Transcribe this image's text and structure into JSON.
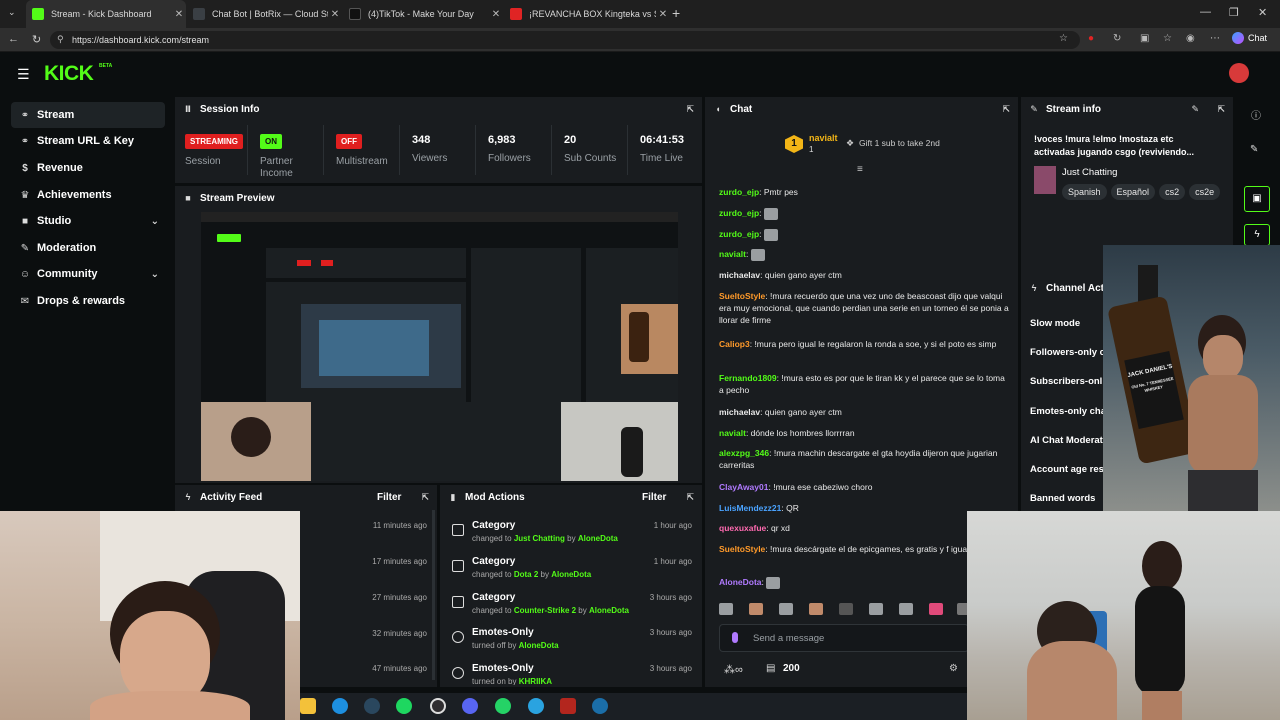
{
  "browser": {
    "tabs": [
      {
        "title": "Stream - Kick Dashboard",
        "active": true,
        "favicon_color": "#53fc18"
      },
      {
        "title": "Chat Bot | BotRix — Cloud Streami",
        "active": false,
        "favicon_color": "#3a3f44"
      },
      {
        "title": "(4)TikTok - Make Your Day",
        "active": false,
        "favicon_color": "#111111"
      },
      {
        "title": "¡REVANCHA BOX Kingteka vs S",
        "active": false,
        "favicon_color": "#e02424"
      }
    ],
    "url": "https://dashboard.kick.com/stream",
    "chat_button": "Chat"
  },
  "app": {
    "logo": "KICK",
    "logo_badge": "BETA",
    "accent": "#53fc18"
  },
  "sidebar": {
    "items": [
      {
        "label": "Stream",
        "icon": "link-icon"
      },
      {
        "label": "Stream URL & Key",
        "icon": "link-icon"
      },
      {
        "label": "Revenue",
        "icon": "dollar-icon"
      },
      {
        "label": "Achievements",
        "icon": "trophy-icon"
      },
      {
        "label": "Studio",
        "icon": "video-icon"
      },
      {
        "label": "Moderation",
        "icon": "wrench-icon"
      },
      {
        "label": "Community",
        "icon": "users-icon"
      },
      {
        "label": "Drops & rewards",
        "icon": "gift-icon"
      }
    ]
  },
  "session": {
    "title": "Session Info",
    "stats": [
      {
        "value": "STREAMING",
        "label": "Session",
        "badge_color": "#e01f1f"
      },
      {
        "value": "ON",
        "label": "Partner Income",
        "badge_color": "#53fc18"
      },
      {
        "value": "OFF",
        "label": "Multistream",
        "badge_color": "#e01f1f"
      },
      {
        "value": "348",
        "label": "Viewers"
      },
      {
        "value": "6,983",
        "label": "Followers"
      },
      {
        "value": "20",
        "label": "Sub Counts"
      },
      {
        "value": "06:41:53",
        "label": "Time Live"
      }
    ]
  },
  "preview": {
    "title": "Stream Preview"
  },
  "activity": {
    "title": "Activity Feed",
    "filter": "Filter",
    "times": [
      "11 minutes ago",
      "17 minutes ago",
      "27 minutes ago",
      "32 minutes ago",
      "47 minutes ago"
    ]
  },
  "mod_actions": {
    "title": "Mod Actions",
    "filter": "Filter",
    "rows": [
      {
        "title": "Category",
        "verb": "changed to",
        "target": "Just Chatting",
        "by": "by",
        "user": "AloneDota",
        "time": "1 hour ago",
        "icon": "category-icon"
      },
      {
        "title": "Category",
        "verb": "changed to",
        "target": "Dota 2",
        "by": "by",
        "user": "AloneDota",
        "time": "1 hour ago",
        "icon": "category-icon"
      },
      {
        "title": "Category",
        "verb": "changed to",
        "target": "Counter-Strike 2",
        "by": "by",
        "user": "AloneDota",
        "time": "3 hours ago",
        "icon": "category-icon"
      },
      {
        "title": "Emotes-Only",
        "verb": "turned off",
        "target": "",
        "by": "by",
        "user": "AloneDota",
        "time": "3 hours ago",
        "icon": "emote-icon"
      },
      {
        "title": "Emotes-Only",
        "verb": "turned on",
        "target": "",
        "by": "by",
        "user": "KHRIIKA",
        "time": "3 hours ago",
        "icon": "emote-icon"
      }
    ]
  },
  "chat": {
    "title": "Chat",
    "pinned_user": "navialt",
    "pinned_count": "1",
    "gift_text": "Gift 1 sub to take 2nd",
    "messages": [
      {
        "user": "zurdo_ejp",
        "color": "#53fc18",
        "text": "Pmtr pes"
      },
      {
        "user": "zurdo_ejp",
        "color": "#53fc18",
        "text": "",
        "emote": true
      },
      {
        "user": "zurdo_ejp",
        "color": "#53fc18",
        "text": "",
        "emote": true
      },
      {
        "user": "navialt",
        "color": "#53fc18",
        "text": "",
        "emote": true
      },
      {
        "user": "michaelav",
        "color": "#e8e8e8",
        "text": "quien gano ayer ctm"
      },
      {
        "user": "SueltoStyle",
        "color": "#ff9a2a",
        "text": "!mura recuerdo que una vez uno de beascoast dijo que valqui era muy emocional, que cuando perdian una serie en un torneo él se ponia a llorar de firme"
      },
      {
        "user": "Caliop3",
        "color": "#ff9a2a",
        "text": "!mura pero igual le regalaron la ronda a soe, y si el poto es simp"
      },
      {
        "user": "Fernando1809",
        "color": "#53fc18",
        "text": "!mura esto es por que le tiran kk y el parece que se lo toma a pecho"
      },
      {
        "user": "michaelav",
        "color": "#e8e8e8",
        "text": "quien gano ayer ctm"
      },
      {
        "user": "navialt",
        "color": "#53fc18",
        "text": "dónde los hombres llorrrran"
      },
      {
        "user": "alexzpg_346",
        "color": "#53fc18",
        "text": "!mura machin descargate el gta hoydia dijeron que jugarian carreritas"
      },
      {
        "user": "ClayAway01",
        "color": "#b07aff",
        "text": "!mura ese cabeziwo choro"
      },
      {
        "user": "LuisMendezz21",
        "color": "#4aa3ff",
        "text": "QR"
      },
      {
        "user": "quexuxafue",
        "color": "#ff6ab0",
        "text": "qr xd"
      },
      {
        "user": "SueltoStyle",
        "color": "#ff9a2a",
        "text": "!mura descárgate el de epicgames, es gratis y f igual"
      },
      {
        "user": "AloneDota",
        "color": "#b07aff",
        "text": "",
        "emote": true
      }
    ],
    "input_placeholder": "Send a message",
    "viewer_count": "200"
  },
  "stream_info": {
    "title": "Stream info",
    "stream_title": "!voces !mura !elmo !mostaza etc activadas jugando csgo (reviviendo...",
    "category": "Just Chatting",
    "tags": [
      "Spanish",
      "Español",
      "cs2",
      "cs2e"
    ]
  },
  "channel_actions": {
    "title": "Channel Acti",
    "items": [
      "Slow mode",
      "Followers-only c",
      "Subscribers-onl",
      "Emotes-only cha",
      "AI Chat Moderat",
      "Account age res",
      "Banned words"
    ]
  },
  "overlay": {
    "bottle_brand": "JACK DANIEL'S",
    "bottle_text": "Old No. 7 TENNESSEE WHISKEY"
  }
}
